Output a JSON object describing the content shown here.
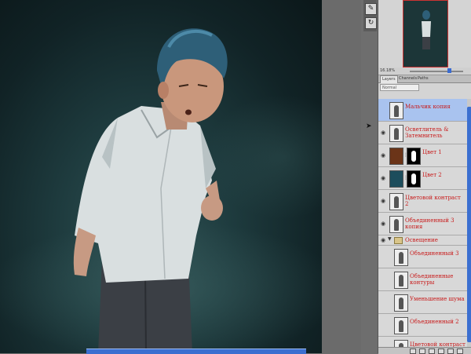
{
  "navigator": {
    "zoom": "16.18%"
  },
  "panel_tabs": [
    "Layers",
    "Channels",
    "Paths"
  ],
  "blend_mode": "Normal",
  "layers": [
    {
      "name": "Мальчик копия",
      "selected": true,
      "thumb": "figure",
      "visible": false
    },
    {
      "name": "Осветлитель & Затемнитель",
      "selected": false,
      "thumb": "figure",
      "visible": true
    },
    {
      "name": "Цвет 1",
      "selected": false,
      "thumb": "color",
      "color": "#6b3418",
      "mask": true,
      "visible": true
    },
    {
      "name": "Цвет 2",
      "selected": false,
      "thumb": "color",
      "color": "#1d4d5c",
      "mask": true,
      "visible": true
    },
    {
      "name": "Цветовой контраст 2",
      "selected": false,
      "thumb": "figure",
      "visible": true
    },
    {
      "name": "Объединенный 3 копия",
      "selected": false,
      "thumb": "figure",
      "visible": true
    },
    {
      "name": "Освещение",
      "selected": false,
      "thumb": "folder",
      "visible": true,
      "group": true
    },
    {
      "name": "Объединенный 3",
      "selected": false,
      "thumb": "figure",
      "visible": false,
      "indent": true
    },
    {
      "name": "Объединенные контуры",
      "selected": false,
      "thumb": "figure",
      "visible": false,
      "indent": true
    },
    {
      "name": "Уменьшение шума",
      "selected": false,
      "thumb": "figure",
      "visible": false,
      "indent": true
    },
    {
      "name": "Объединенный 2",
      "selected": false,
      "thumb": "figure",
      "visible": false,
      "indent": true
    },
    {
      "name": "Цветовой контраст",
      "selected": false,
      "thumb": "figure",
      "visible": false,
      "indent": true
    }
  ],
  "colors": {
    "canvas_bg": "#1e3b3e",
    "layer_text": "#c81a1a",
    "selection": "#a9c3ef",
    "scrollbar": "#3b6fd0"
  }
}
